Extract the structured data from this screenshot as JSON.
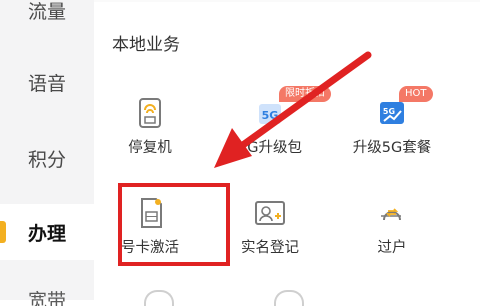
{
  "sidebar": {
    "items": [
      {
        "label": "流量"
      },
      {
        "label": "语音"
      },
      {
        "label": "积分"
      },
      {
        "label": "办理"
      }
    ],
    "partial_label": "宽带"
  },
  "main": {
    "section_title": "本地业务",
    "services": [
      {
        "label": "停复机",
        "icon": "sim-power-icon"
      },
      {
        "label": "5G升级包",
        "icon": "5g-icon",
        "tag": "限时折扣"
      },
      {
        "label": "升级5G套餐",
        "icon": "5g-upgrade-icon",
        "tag": "HOT"
      },
      {
        "label": "号卡激活",
        "icon": "sim-card-icon"
      },
      {
        "label": "实名登记",
        "icon": "id-card-icon"
      },
      {
        "label": "过户",
        "icon": "transfer-icon"
      }
    ]
  },
  "colors": {
    "accent": "#f3b021",
    "highlight": "#e02222",
    "tag": "#f36a56",
    "icon_blue": "#2f7fe0"
  }
}
